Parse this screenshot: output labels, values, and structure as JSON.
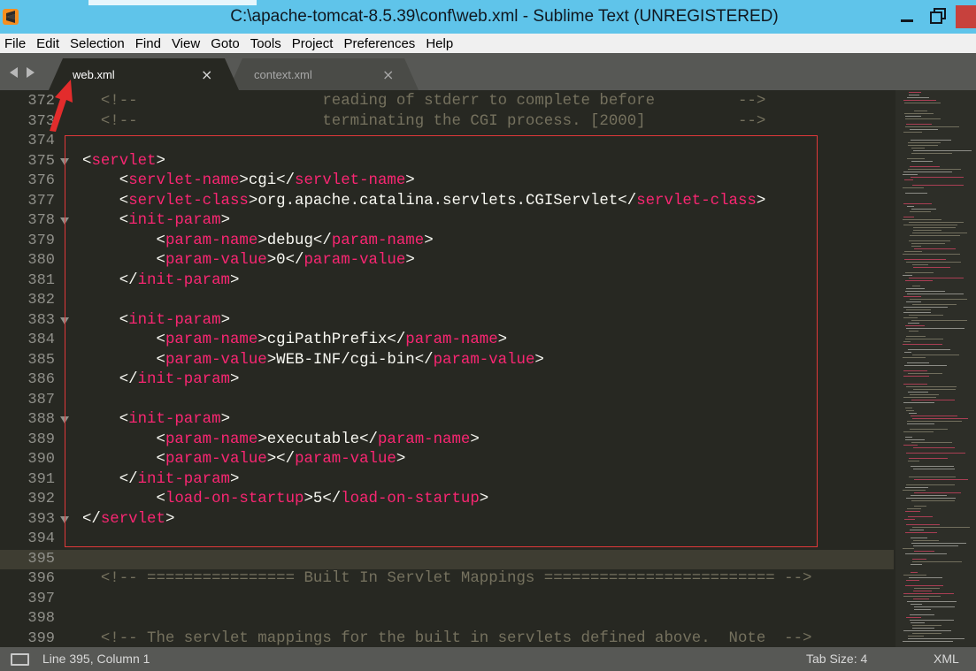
{
  "window": {
    "title": "C:\\apache-tomcat-8.5.39\\conf\\web.xml - Sublime Text (UNREGISTERED)"
  },
  "menu": [
    "File",
    "Edit",
    "Selection",
    "Find",
    "View",
    "Goto",
    "Tools",
    "Project",
    "Preferences",
    "Help"
  ],
  "tabs": [
    {
      "label": "web.xml",
      "active": true
    },
    {
      "label": "context.xml",
      "active": false
    }
  ],
  "icons": {
    "app": "sublime-text-icon",
    "minimize": "minimize-icon",
    "maximize": "restore-icon",
    "close": "close-icon",
    "tab_close": "×",
    "nav_left": "chevron-left-icon",
    "nav_right": "chevron-right-icon",
    "status": "panel-toggle-icon"
  },
  "editor": {
    "current_line": 395,
    "lines": [
      {
        "n": "372",
        "fold": false,
        "segs": [
          [
            "comment",
            "  <!--                    reading of stderr to complete before         -->"
          ]
        ]
      },
      {
        "n": "373",
        "fold": false,
        "segs": [
          [
            "comment",
            "  <!--                    terminating the CGI process. [2000]          -->"
          ]
        ]
      },
      {
        "n": "374",
        "fold": false,
        "segs": []
      },
      {
        "n": "375",
        "fold": true,
        "segs": [
          [
            "punct",
            "<"
          ],
          [
            "tag",
            "servlet"
          ],
          [
            "punct",
            ">"
          ]
        ]
      },
      {
        "n": "376",
        "fold": false,
        "segs": [
          [
            "punct",
            "    <"
          ],
          [
            "tag",
            "servlet-name"
          ],
          [
            "punct",
            ">cgi</"
          ],
          [
            "tag",
            "servlet-name"
          ],
          [
            "punct",
            ">"
          ]
        ]
      },
      {
        "n": "377",
        "fold": false,
        "segs": [
          [
            "punct",
            "    <"
          ],
          [
            "tag",
            "servlet-class"
          ],
          [
            "punct",
            ">org.apache.catalina.servlets.CGIServlet</"
          ],
          [
            "tag",
            "servlet-class"
          ],
          [
            "punct",
            ">"
          ]
        ]
      },
      {
        "n": "378",
        "fold": true,
        "segs": [
          [
            "punct",
            "    <"
          ],
          [
            "tag",
            "init-param"
          ],
          [
            "punct",
            ">"
          ]
        ]
      },
      {
        "n": "379",
        "fold": false,
        "segs": [
          [
            "punct",
            "        <"
          ],
          [
            "tag",
            "param-name"
          ],
          [
            "punct",
            ">debug</"
          ],
          [
            "tag",
            "param-name"
          ],
          [
            "punct",
            ">"
          ]
        ]
      },
      {
        "n": "380",
        "fold": false,
        "segs": [
          [
            "punct",
            "        <"
          ],
          [
            "tag",
            "param-value"
          ],
          [
            "punct",
            ">0</"
          ],
          [
            "tag",
            "param-value"
          ],
          [
            "punct",
            ">"
          ]
        ]
      },
      {
        "n": "381",
        "fold": false,
        "segs": [
          [
            "punct",
            "    </"
          ],
          [
            "tag",
            "init-param"
          ],
          [
            "punct",
            ">"
          ]
        ]
      },
      {
        "n": "382",
        "fold": false,
        "segs": []
      },
      {
        "n": "383",
        "fold": true,
        "segs": [
          [
            "punct",
            "    <"
          ],
          [
            "tag",
            "init-param"
          ],
          [
            "punct",
            ">"
          ]
        ]
      },
      {
        "n": "384",
        "fold": false,
        "segs": [
          [
            "punct",
            "        <"
          ],
          [
            "tag",
            "param-name"
          ],
          [
            "punct",
            ">cgiPathPrefix</"
          ],
          [
            "tag",
            "param-name"
          ],
          [
            "punct",
            ">"
          ]
        ]
      },
      {
        "n": "385",
        "fold": false,
        "segs": [
          [
            "punct",
            "        <"
          ],
          [
            "tag",
            "param-value"
          ],
          [
            "punct",
            ">WEB-INF/cgi-bin</"
          ],
          [
            "tag",
            "param-value"
          ],
          [
            "punct",
            ">"
          ]
        ]
      },
      {
        "n": "386",
        "fold": false,
        "segs": [
          [
            "punct",
            "    </"
          ],
          [
            "tag",
            "init-param"
          ],
          [
            "punct",
            ">"
          ]
        ]
      },
      {
        "n": "387",
        "fold": false,
        "segs": []
      },
      {
        "n": "388",
        "fold": true,
        "segs": [
          [
            "punct",
            "    <"
          ],
          [
            "tag",
            "init-param"
          ],
          [
            "punct",
            ">"
          ]
        ]
      },
      {
        "n": "389",
        "fold": false,
        "segs": [
          [
            "punct",
            "        <"
          ],
          [
            "tag",
            "param-name"
          ],
          [
            "punct",
            ">executable</"
          ],
          [
            "tag",
            "param-name"
          ],
          [
            "punct",
            ">"
          ]
        ]
      },
      {
        "n": "390",
        "fold": false,
        "segs": [
          [
            "punct",
            "        <"
          ],
          [
            "tag",
            "param-value"
          ],
          [
            "punct",
            "></"
          ],
          [
            "tag",
            "param-value"
          ],
          [
            "punct",
            ">"
          ]
        ]
      },
      {
        "n": "391",
        "fold": false,
        "segs": [
          [
            "punct",
            "    </"
          ],
          [
            "tag",
            "init-param"
          ],
          [
            "punct",
            ">"
          ]
        ]
      },
      {
        "n": "392",
        "fold": false,
        "segs": [
          [
            "punct",
            "        <"
          ],
          [
            "tag",
            "load-on-startup"
          ],
          [
            "punct",
            ">5</"
          ],
          [
            "tag",
            "load-on-startup"
          ],
          [
            "punct",
            ">"
          ]
        ]
      },
      {
        "n": "393",
        "fold": true,
        "segs": [
          [
            "punct",
            "</"
          ],
          [
            "tag",
            "servlet"
          ],
          [
            "punct",
            ">"
          ]
        ]
      },
      {
        "n": "394",
        "fold": false,
        "segs": []
      },
      {
        "n": "395",
        "fold": false,
        "segs": []
      },
      {
        "n": "396",
        "fold": false,
        "segs": [
          [
            "comment",
            "  <!-- ================ Built In Servlet Mappings ========================= -->"
          ]
        ]
      },
      {
        "n": "397",
        "fold": false,
        "segs": []
      },
      {
        "n": "398",
        "fold": false,
        "segs": []
      },
      {
        "n": "399",
        "fold": false,
        "segs": [
          [
            "comment",
            "  <!-- The servlet mappings for the built in servlets defined above.  Note  -->"
          ]
        ]
      }
    ]
  },
  "status": {
    "position": "Line 395, Column 1",
    "tab_size": "Tab Size: 4",
    "syntax": "XML"
  },
  "colors": {
    "title_bar": "#5fc4ea",
    "editor_bg": "#272822",
    "tag": "#f92672",
    "comment": "#75715e",
    "annotation_red": "#e0383a"
  }
}
